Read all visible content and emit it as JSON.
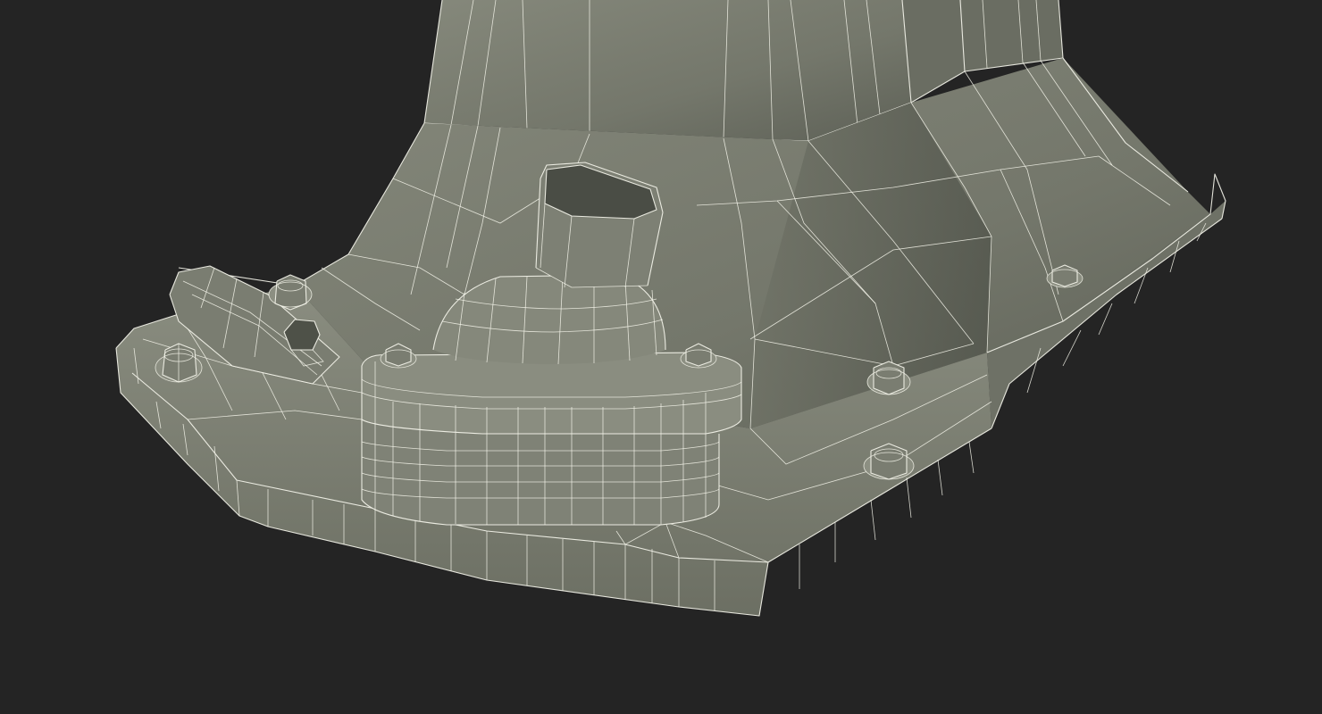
{
  "scene": {
    "kind": "wireframe-3d-render",
    "background_color": "#242424",
    "mesh_fill_color": "#7c7f72",
    "mesh_shadow_color": "#55584e",
    "mesh_light_color": "#8d9083",
    "wire_color": "#f4f4ea"
  }
}
